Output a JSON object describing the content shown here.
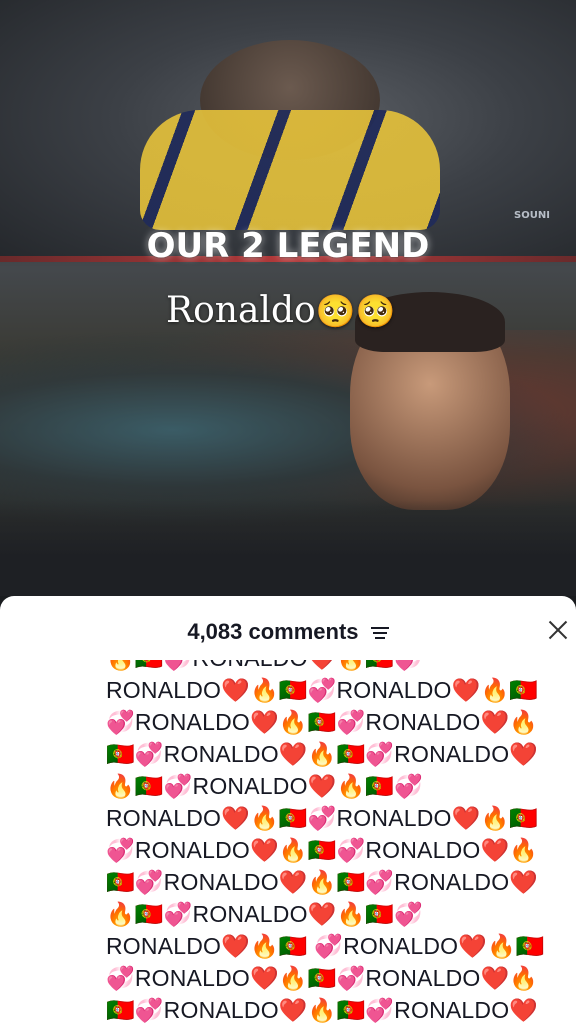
{
  "video": {
    "overlay_title": "OUR 2 LEGEND",
    "channel_mark": "SOUNI",
    "caption": "Ronaldo",
    "caption_emoji": "🥺🥺"
  },
  "comments_panel": {
    "count_label": "4,083 comments",
    "filter_icon": "filter-lines-icon",
    "close_icon": "close-icon",
    "lines": [
      "🔥🇵🇹💞RONALDO❤️🔥🇵🇹💞",
      "RONALDO❤️🔥🇵🇹💞RONALDO❤️🔥🇵🇹",
      "💞RONALDO❤️🔥🇵🇹💞RONALDO❤️🔥",
      "🇵🇹💞RONALDO❤️🔥🇵🇹💞RONALDO❤️",
      "🔥🇵🇹💞RONALDO❤️🔥🇵🇹💞",
      "RONALDO❤️🔥🇵🇹💞RONALDO❤️🔥🇵🇹",
      "💞RONALDO❤️🔥🇵🇹💞RONALDO❤️🔥",
      "🇵🇹💞RONALDO❤️🔥🇵🇹💞RONALDO❤️",
      "🔥🇵🇹💞RONALDO❤️🔥🇵🇹💞",
      "RONALDO❤️🔥🇵🇹 💞RONALDO❤️🔥🇵🇹",
      "💞RONALDO❤️🔥🇵🇹💞RONALDO❤️🔥",
      "🇵🇹💞RONALDO❤️🔥🇵🇹💞RONALDO❤️"
    ]
  }
}
